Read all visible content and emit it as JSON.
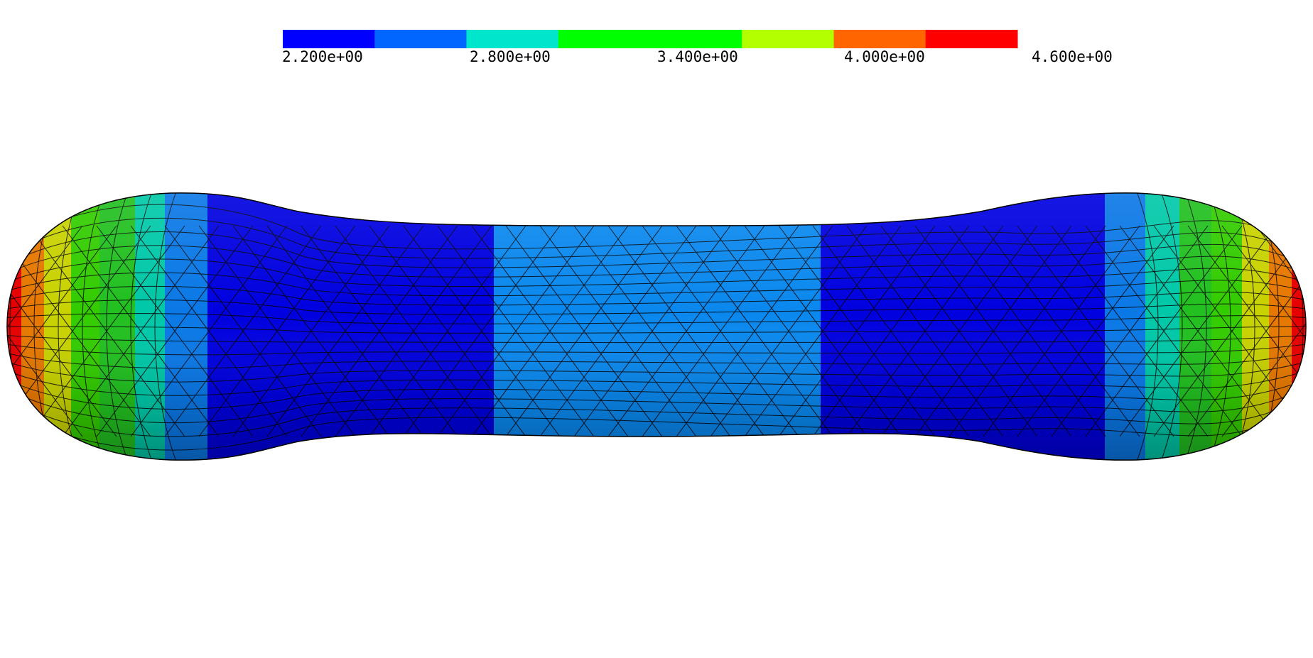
{
  "colorbar": {
    "bands": [
      "#0000ff",
      "#0066ff",
      "#00e6cc",
      "#00ff00",
      "#00ff00",
      "#b3ff00",
      "#ff6600",
      "#ff0000"
    ],
    "labels": [
      "2.200e+00",
      "2.800e+00",
      "3.400e+00",
      "4.000e+00",
      "4.600e+00"
    ]
  },
  "surface": {
    "band_colors": {
      "tip": "#e60000",
      "orange": "#e67800",
      "yellow": "#c8d200",
      "green": "#33cc00",
      "cyan": "#00c8a8",
      "lightblue": "#0a78e6",
      "darkblue": "#0000e0",
      "midblue": "#0a88ee"
    },
    "mesh_color": "#000000"
  }
}
